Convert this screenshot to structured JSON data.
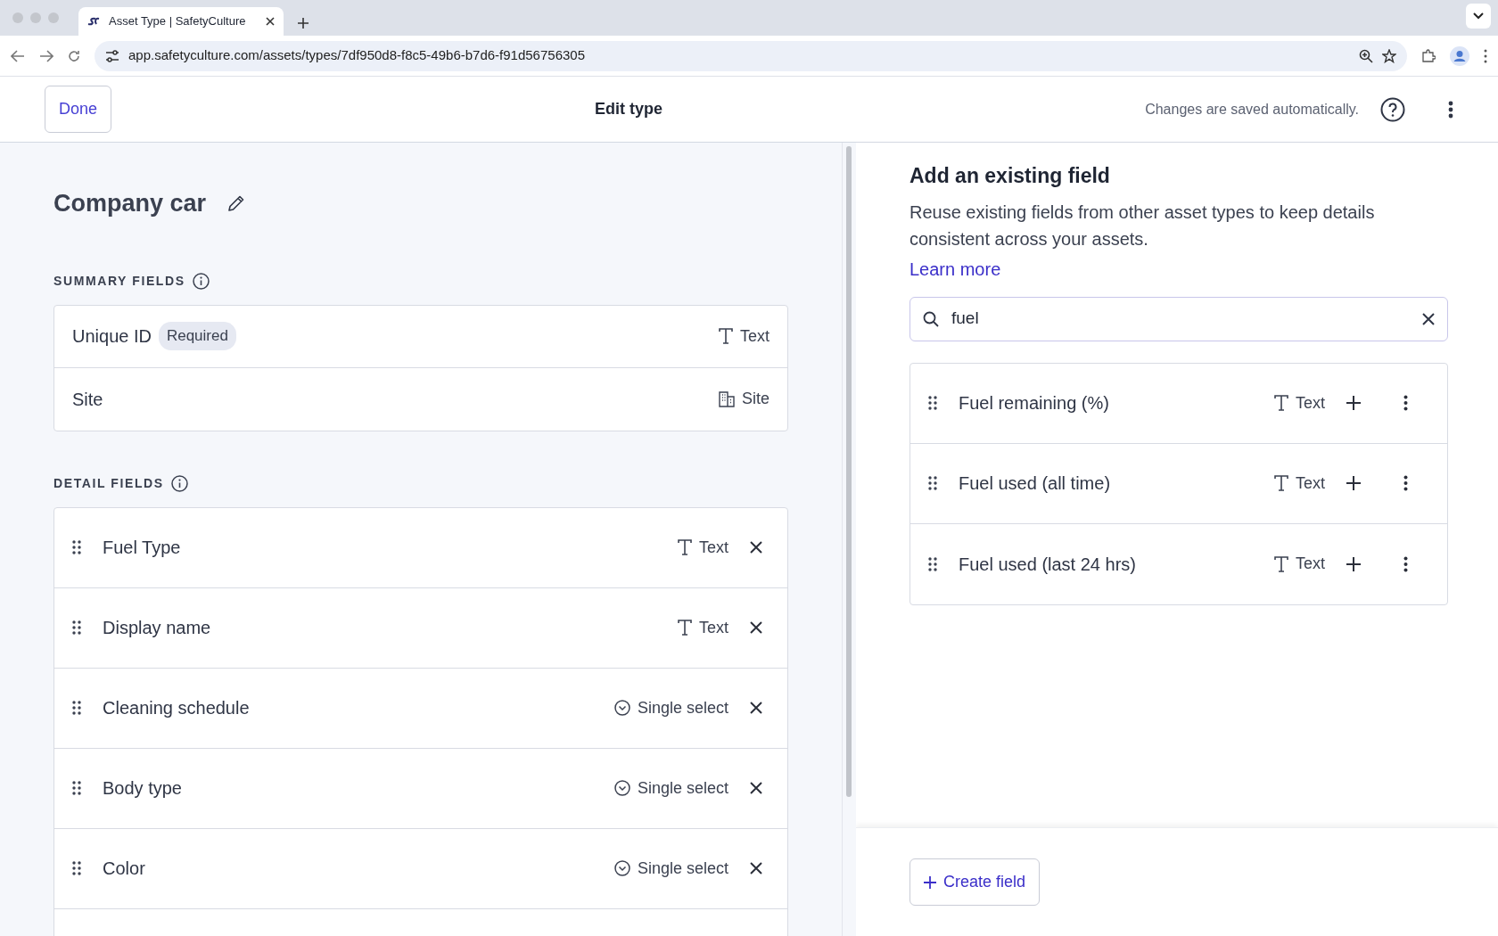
{
  "browser": {
    "tab_title": "Asset Type | SafetyCulture",
    "url": "app.safetyculture.com/assets/types/7df950d8-f8c5-49b6-b7d6-f91d56756305"
  },
  "header": {
    "done_button": "Done",
    "title": "Edit type",
    "save_status": "Changes are saved automatically."
  },
  "asset_name": "Company car",
  "summary_fields": {
    "label": "SUMMARY FIELDS",
    "fields": [
      {
        "name": "Unique ID",
        "badge": "Required",
        "type_label": "Text",
        "kind": "text"
      },
      {
        "name": "Site",
        "type_label": "Site",
        "kind": "site"
      }
    ]
  },
  "detail_fields": {
    "label": "DETAIL FIELDS",
    "fields": [
      {
        "name": "Fuel Type",
        "type_label": "Text",
        "kind": "text"
      },
      {
        "name": "Display name",
        "type_label": "Text",
        "kind": "text"
      },
      {
        "name": "Cleaning schedule",
        "type_label": "Single select",
        "kind": "single_select"
      },
      {
        "name": "Body type",
        "type_label": "Single select",
        "kind": "single_select"
      },
      {
        "name": "Color",
        "type_label": "Single select",
        "kind": "single_select"
      }
    ]
  },
  "existing_fields": {
    "title": "Add an existing field",
    "description": "Reuse existing fields from other asset types to keep details consistent across your assets.",
    "learn_more": "Learn more",
    "search": {
      "value": "fuel"
    },
    "results": [
      {
        "name": "Fuel remaining (%)",
        "type_label": "Text",
        "kind": "text"
      },
      {
        "name": "Fuel used (all time)",
        "type_label": "Text",
        "kind": "text"
      },
      {
        "name": "Fuel used (last 24 hrs)",
        "type_label": "Text",
        "kind": "text"
      }
    ]
  },
  "create_button": "Create field"
}
